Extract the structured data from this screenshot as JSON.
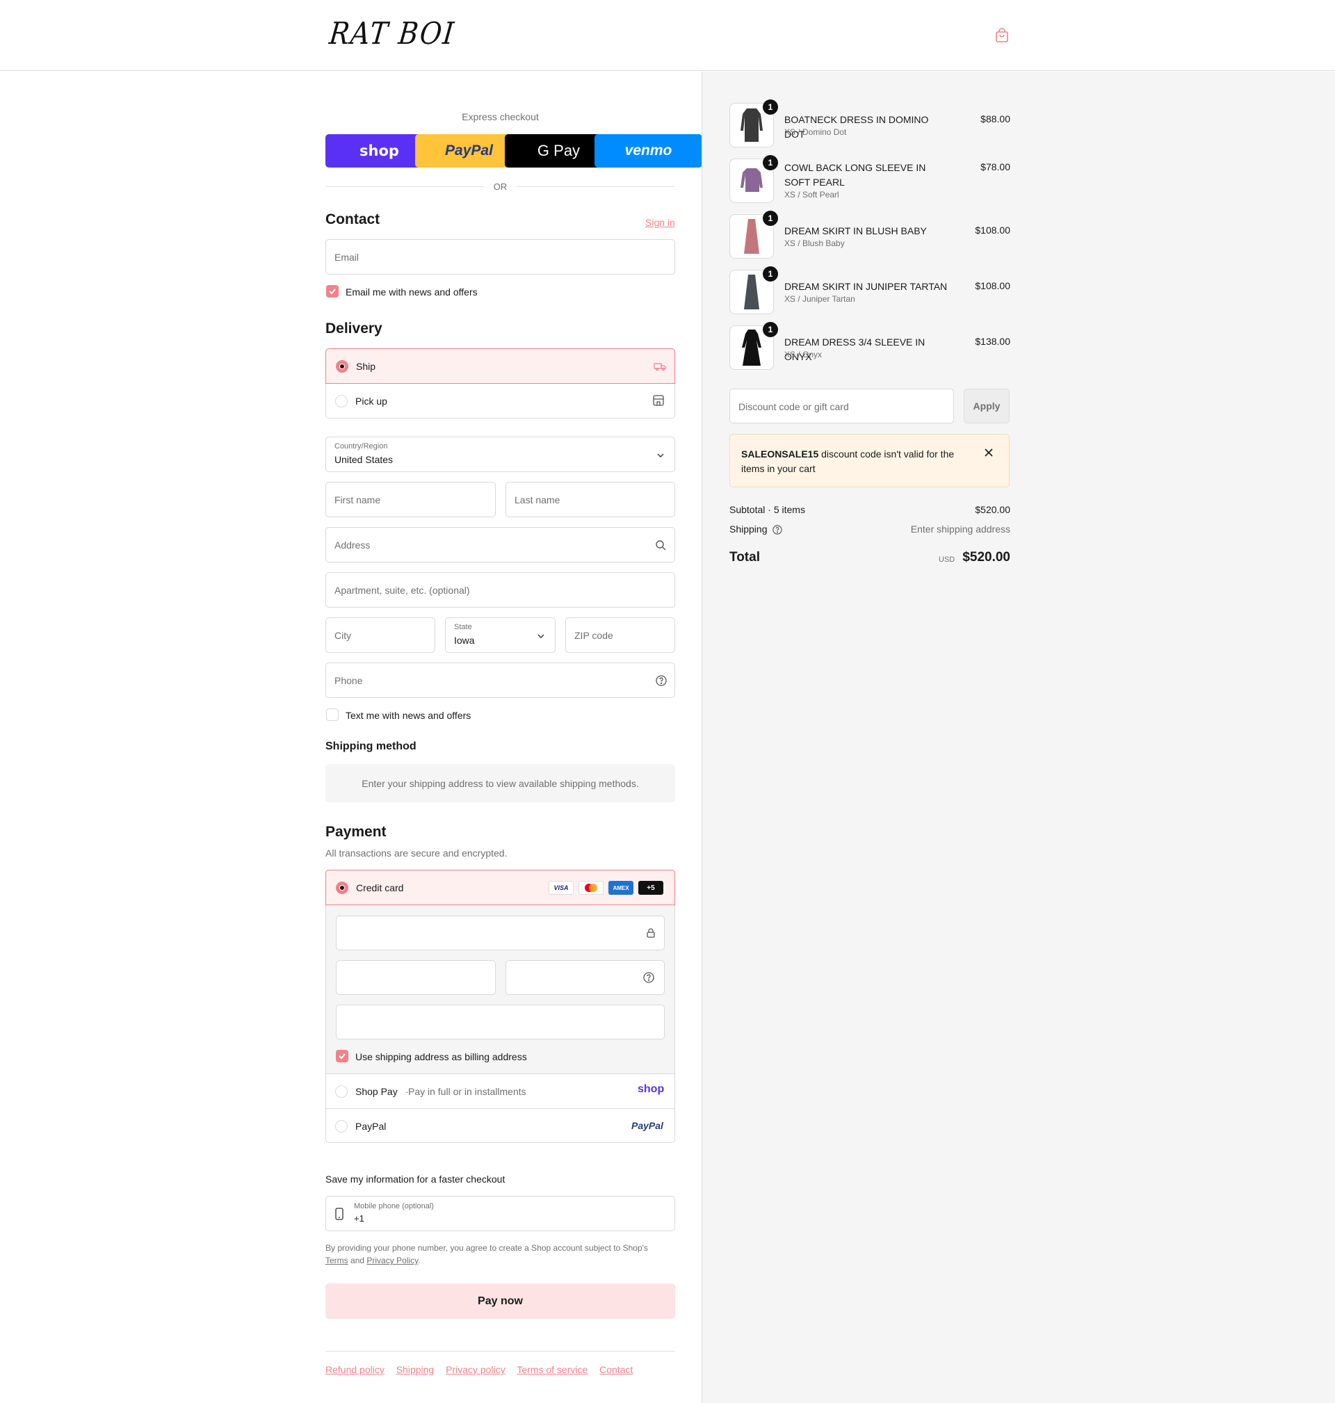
{
  "header": {
    "logo_text": "RAT BOI",
    "cart_icon": "shopping-bag-icon"
  },
  "express": {
    "label": "Express checkout",
    "buttons": [
      {
        "label": "shop",
        "bg": "#5a31f4",
        "color": "#ffffff"
      },
      {
        "label": "PayPal",
        "bg": "#ffc439",
        "color": "#253b80"
      },
      {
        "label": "G Pay",
        "bg": "#000000",
        "color": "#ffffff"
      },
      {
        "label": "venmo",
        "bg": "#008cff",
        "color": "#ffffff"
      }
    ],
    "or_text": "OR"
  },
  "contact": {
    "title": "Contact",
    "sign_in": "Sign in",
    "email_placeholder": "Email",
    "news_checkbox": "Email me with news and offers",
    "news_checked": true
  },
  "delivery": {
    "title": "Delivery",
    "options": [
      {
        "label": "Ship",
        "selected": true,
        "icon": "truck-icon"
      },
      {
        "label": "Pick up",
        "selected": false,
        "icon": "store-icon"
      }
    ],
    "country_label": "Country/Region",
    "country_value": "United States",
    "first_name_ph": "First name",
    "last_name_ph": "Last name",
    "address_ph": "Address",
    "apt_ph": "Apartment, suite, etc. (optional)",
    "city_ph": "City",
    "state_label": "State",
    "state_value": "Iowa",
    "zip_ph": "ZIP code",
    "phone_ph": "Phone",
    "text_checkbox": "Text me with news and offers",
    "text_checked": false
  },
  "shipping_method": {
    "title": "Shipping method",
    "notice": "Enter your shipping address to view available shipping methods."
  },
  "payment": {
    "title": "Payment",
    "subtitle": "All transactions are secure and encrypted.",
    "credit_card_label": "Credit card",
    "card_logos": [
      "VISA",
      "MC",
      "AMEX",
      "+5"
    ],
    "billing_checkbox": "Use shipping address as billing address",
    "billing_checked": true,
    "shop_pay_label": "Shop Pay",
    "shop_pay_sub": "Pay in full or in installments",
    "shop_pay_logo": "shop",
    "paypal_label": "PayPal",
    "paypal_logo": "PayPal"
  },
  "save_info": {
    "title": "Save my information for a faster checkout",
    "mobile_label": "Mobile phone (optional)",
    "mobile_value": "+1",
    "disclaimer_1": "By providing your phone number, you agree to create a Shop account subject to Shop's",
    "terms": "Terms",
    "and": "and",
    "privacy": "Privacy Policy",
    "period": "."
  },
  "pay_now": "Pay now",
  "footer": [
    "Refund policy",
    "Shipping",
    "Privacy policy",
    "Terms of service",
    "Contact"
  ],
  "colors": {
    "accent": "#f2818a",
    "selected_bg": "#fff0f0",
    "pay_btn_bg": "#fde3e4"
  },
  "summary": {
    "items": [
      {
        "name": "BOATNECK DRESS IN DOMINO DOT",
        "variant": "XS / Domino Dot",
        "price": "$88.00",
        "qty": "1",
        "color": "#3a3a3a"
      },
      {
        "name": "COWL BACK LONG SLEEVE IN SOFT PEARL",
        "variant": "XS / Soft Pearl",
        "price": "$78.00",
        "qty": "1",
        "color": "#8a6796"
      },
      {
        "name": "DREAM SKIRT IN BLUSH BABY",
        "variant": "XS / Blush Baby",
        "price": "$108.00",
        "qty": "1",
        "color": "#c4757c"
      },
      {
        "name": "DREAM SKIRT IN JUNIPER TARTAN",
        "variant": "XS / Juniper Tartan",
        "price": "$108.00",
        "qty": "1",
        "color": "#4a4f56"
      },
      {
        "name": "DREAM DRESS 3/4 SLEEVE IN ONYX",
        "variant": "XS / Onyx",
        "price": "$138.00",
        "qty": "1",
        "color": "#111111"
      }
    ],
    "discount_ph": "Discount code or gift card",
    "apply": "Apply",
    "error_code": "SALEONSALE15",
    "error_msg": "discount code isn't valid for the items in your cart",
    "subtotal_label": "Subtotal · 5 items",
    "subtotal_value": "$520.00",
    "shipping_label": "Shipping",
    "shipping_value": "Enter shipping address",
    "total_label": "Total",
    "currency": "USD",
    "total_value": "$520.00"
  }
}
